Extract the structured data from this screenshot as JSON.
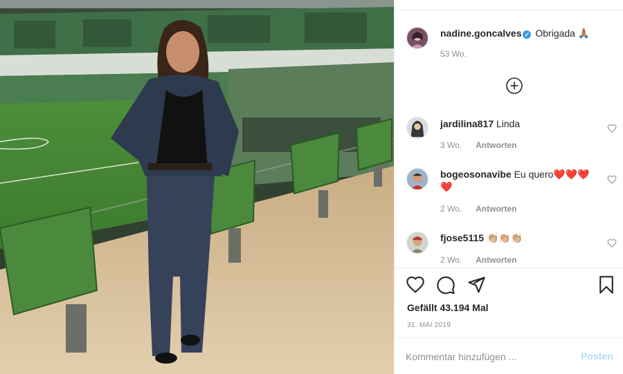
{
  "post": {
    "author": "nadine.goncalves",
    "caption": "Obrigada 🙏🏽",
    "age": "53 Wo.",
    "likes": "Gefällt 43.194 Mal",
    "date": "31. MAI 2019"
  },
  "comments": [
    {
      "user": "jardilina817",
      "text": "Linda",
      "age": "3 Wo.",
      "reply_label": "Antworten"
    },
    {
      "user": "bogeosonavibe",
      "text": "Eu quero❤️❤️❤️❤️",
      "age": "2 Wo.",
      "reply_label": "Antworten"
    },
    {
      "user": "fjose5115",
      "text": "👏🏼👏🏼👏🏼",
      "age": "2 Wo.",
      "reply_label": "Antworten"
    }
  ],
  "composer": {
    "placeholder": "Kommentar hinzufügen ...",
    "post_label": "Posten"
  },
  "icons": {
    "verified": "verified-badge-icon",
    "load_more": "plus-circle-icon",
    "like": "heart-icon",
    "comment": "comment-bubble-icon",
    "share": "paper-plane-icon",
    "save": "bookmark-icon"
  },
  "colors": {
    "verified_blue": "#3897f0",
    "post_button_disabled": "#b2dffc",
    "muted_text": "#8e8e8e"
  }
}
